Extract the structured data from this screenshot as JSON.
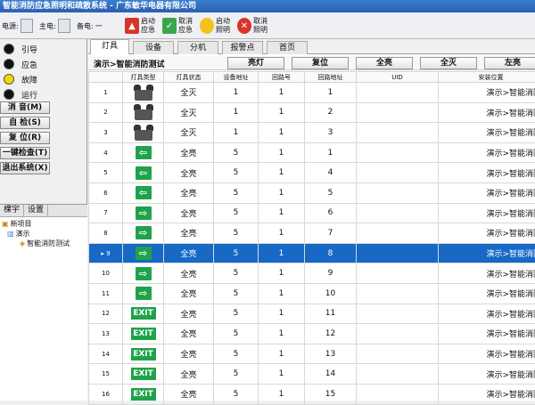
{
  "window": {
    "title": "智能消防应急照明和疏散系统 - 广东敏华电器有限公司"
  },
  "toolbar": {
    "power": [
      {
        "label": "电源:",
        "value": ""
      },
      {
        "label": "主电:",
        "value": ""
      },
      {
        "label": "备电:",
        "value": "一"
      }
    ],
    "buttons": [
      {
        "label": "启动应急",
        "icon": "fire-icon",
        "color": "#d9342b"
      },
      {
        "label": "取消应急",
        "icon": "check-icon",
        "color": "#3aa64a"
      },
      {
        "label": "启动照明",
        "icon": "bulb-icon",
        "color": "#f2c21b"
      },
      {
        "label": "取消照明",
        "icon": "cancel-icon",
        "color": "#d9342b"
      }
    ]
  },
  "status": [
    {
      "label": "引导",
      "color": "#111111"
    },
    {
      "label": "应急",
      "color": "#111111"
    },
    {
      "label": "故障",
      "color": "#f5d800"
    },
    {
      "label": "运行",
      "color": "#111111"
    }
  ],
  "side_buttons": [
    "消 音(M)",
    "自 检(S)",
    "复 位(R)",
    "一键检查(T)",
    "退出系统(X)"
  ],
  "tree": {
    "tabs": [
      "棵宇",
      "设置"
    ],
    "nodes": [
      "新项目",
      "演示",
      "智能消防测试"
    ]
  },
  "tabs": [
    "灯具",
    "设备",
    "分机",
    "报警点",
    "首页"
  ],
  "actionbar": {
    "title": "演示>智能消防测试",
    "buttons": [
      "亮灯",
      "复位",
      "全亮",
      "全灭",
      "左亮"
    ]
  },
  "table": {
    "headers": [
      "",
      "灯具类型",
      "灯具状态",
      "设备地址",
      "回路号",
      "回路地址",
      "UID",
      "安装位置"
    ],
    "selected_row": 8,
    "rows": [
      {
        "no": "1",
        "type": "lamp",
        "state": "全灭",
        "device": "1",
        "loop": "1",
        "addr": "1",
        "uid": "",
        "loc": "演示>智能消防"
      },
      {
        "no": "2",
        "type": "lamp",
        "state": "全灭",
        "device": "1",
        "loop": "1",
        "addr": "2",
        "uid": "",
        "loc": "演示>智能消防"
      },
      {
        "no": "3",
        "type": "lamp",
        "state": "全灭",
        "device": "1",
        "loop": "1",
        "addr": "3",
        "uid": "",
        "loc": "演示>智能消防"
      },
      {
        "no": "4",
        "type": "arrow-left",
        "state": "全亮",
        "device": "5",
        "loop": "1",
        "addr": "1",
        "uid": "",
        "loc": "演示>智能消防"
      },
      {
        "no": "5",
        "type": "arrow-left",
        "state": "全亮",
        "device": "5",
        "loop": "1",
        "addr": "4",
        "uid": "",
        "loc": "演示>智能消防"
      },
      {
        "no": "6",
        "type": "arrow-left",
        "state": "全亮",
        "device": "5",
        "loop": "1",
        "addr": "5",
        "uid": "",
        "loc": "演示>智能消防"
      },
      {
        "no": "7",
        "type": "arrow-right",
        "state": "全亮",
        "device": "5",
        "loop": "1",
        "addr": "6",
        "uid": "",
        "loc": "演示>智能消防"
      },
      {
        "no": "8",
        "type": "arrow-right",
        "state": "全亮",
        "device": "5",
        "loop": "1",
        "addr": "7",
        "uid": "",
        "loc": "演示>智能消防"
      },
      {
        "no": "9",
        "type": "arrow-right",
        "state": "全亮",
        "device": "5",
        "loop": "1",
        "addr": "8",
        "uid": "",
        "loc": "演示>智能消防"
      },
      {
        "no": "10",
        "type": "arrow-right",
        "state": "全亮",
        "device": "5",
        "loop": "1",
        "addr": "9",
        "uid": "",
        "loc": "演示>智能消防"
      },
      {
        "no": "11",
        "type": "arrow-right",
        "state": "全亮",
        "device": "5",
        "loop": "1",
        "addr": "10",
        "uid": "",
        "loc": "演示>智能消防"
      },
      {
        "no": "12",
        "type": "exit",
        "state": "全亮",
        "device": "5",
        "loop": "1",
        "addr": "11",
        "uid": "",
        "loc": "演示>智能消防"
      },
      {
        "no": "13",
        "type": "exit",
        "state": "全亮",
        "device": "5",
        "loop": "1",
        "addr": "12",
        "uid": "",
        "loc": "演示>智能消防"
      },
      {
        "no": "14",
        "type": "exit",
        "state": "全亮",
        "device": "5",
        "loop": "1",
        "addr": "13",
        "uid": "",
        "loc": "演示>智能消防"
      },
      {
        "no": "15",
        "type": "exit",
        "state": "全亮",
        "device": "5",
        "loop": "1",
        "addr": "14",
        "uid": "",
        "loc": "演示>智能消防"
      },
      {
        "no": "16",
        "type": "exit",
        "state": "全亮",
        "device": "5",
        "loop": "1",
        "addr": "15",
        "uid": "",
        "loc": "演示>智能消防"
      }
    ]
  },
  "signs": {
    "exit_text": "EXIT",
    "arrow_left": "⇦",
    "arrow_right": "⇨",
    "row_pointer": "▸"
  },
  "colors": {
    "selection": "#1769c6",
    "sign_green": "#1fa34a",
    "title_blue": "#2a5fb0"
  }
}
